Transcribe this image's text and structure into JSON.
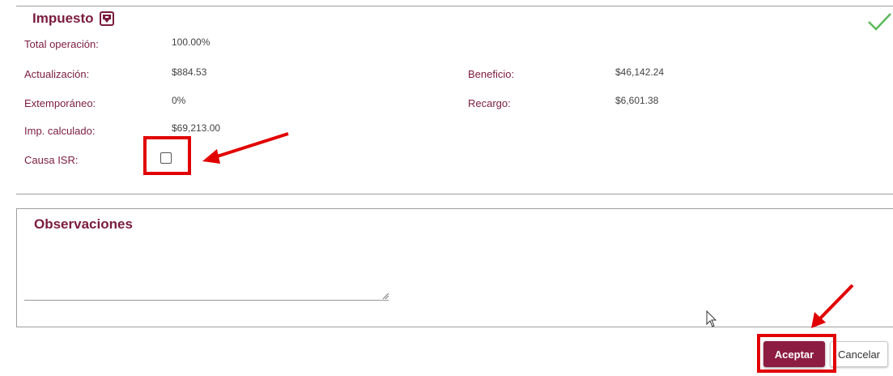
{
  "impuesto": {
    "title": "Impuesto",
    "icon": "download-icon",
    "fields": {
      "total_operacion": {
        "label": "Total operación:",
        "value": "100.00%"
      },
      "actualizacion": {
        "label": "Actualización:",
        "value": "$884.53"
      },
      "extemporaneo": {
        "label": "Extemporáneo:",
        "value": "0%"
      },
      "imp_calculado": {
        "label": "Imp. calculado:",
        "value": "$69,213.00"
      },
      "beneficio": {
        "label": "Beneficio:",
        "value": "$46,142.24"
      },
      "recargo": {
        "label": "Recargo:",
        "value": "$6,601.38"
      },
      "causa_isr": {
        "label": "Causa ISR:",
        "checked": false
      }
    }
  },
  "observaciones": {
    "title": "Observaciones",
    "value": ""
  },
  "actions": {
    "accept_label": "Aceptar",
    "cancel_label": "Cancelar"
  },
  "colors": {
    "brand": "#7b1c3b",
    "accept_button": "#8d1c43",
    "highlight": "#e10000",
    "success_check": "#5cb85c"
  }
}
